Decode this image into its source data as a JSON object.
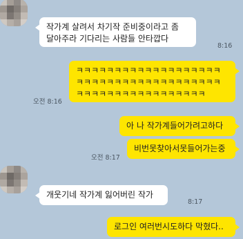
{
  "messages": [
    {
      "side": "in",
      "text": "작가계 살려서 차기작 준비중이라고 좀\n달아주라 기다리는 사람들 안타깝다",
      "time": "8:16"
    },
    {
      "side": "out",
      "text": "ㅋㅋㅋㅋㅋㅋㅋㅋㅋㅋㅋㅋㅋㅋㅋㅋㅋㅋㅋ\nㅋㅋㅋㅋㅋㅋㅋㅋㅋㅋㅋㅋㅋㅋㅋㅋㅋㅋㅋ\nㅋㅋㅋㅋㅋㅋㅋㅋㅋㅋㅋㅋㅋㅋㅋㅋㅋ",
      "time": "오전 8:16"
    },
    {
      "side": "out",
      "text": "아 나 작가계들어가려고하다",
      "time": ""
    },
    {
      "side": "out",
      "text": "비번못찾아서못들어가는중",
      "time": "오전 8:17"
    },
    {
      "side": "in",
      "text": "개웃기네 작가계 잃어버린 작가",
      "time": "8:17"
    },
    {
      "side": "out",
      "text": "로그인 여러번시도하다 막혔다..",
      "time": ""
    }
  ],
  "colors": {
    "background": "#b4c7d9",
    "incoming": "#ffffff",
    "outgoing": "#fee500"
  }
}
